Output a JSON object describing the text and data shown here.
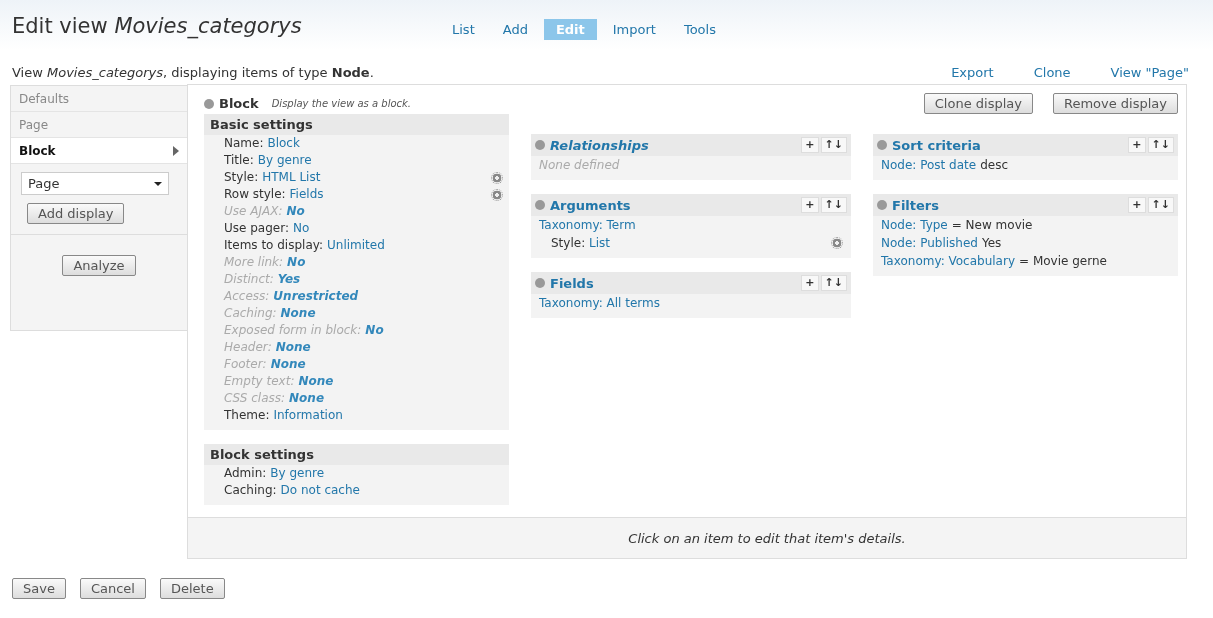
{
  "page_title": {
    "text": "Edit view",
    "name": "Movies_categorys"
  },
  "tabs": [
    {
      "label": "List",
      "selected": false
    },
    {
      "label": "Add",
      "selected": false
    },
    {
      "label": "Edit",
      "selected": true
    },
    {
      "label": "Import",
      "selected": false
    },
    {
      "label": "Tools",
      "selected": false
    }
  ],
  "description": {
    "text": "View *Movies_categorys*, displaying items of type **Node**."
  },
  "links": [
    "Export",
    "Clone",
    "View \"Page\""
  ],
  "displays": [
    {
      "label": "Defaults",
      "selected": false
    },
    {
      "label": "Page",
      "selected": false
    },
    {
      "label": "Block",
      "selected": true
    }
  ],
  "display_select": {
    "value": "Page"
  },
  "add_display_button": "Add display",
  "analyze_button": "Analyze",
  "display_header": {
    "title": "Block",
    "description": "Display the view as a block."
  },
  "display_buttons": [
    "Clone display",
    "Remove display"
  ],
  "basic_settings": {
    "title": "Basic settings",
    "items": [
      {
        "label": "Name:",
        "value": "Block",
        "defaulted": false,
        "settings_icon": false
      },
      {
        "label": "Title:",
        "value": "By genre",
        "defaulted": false,
        "settings_icon": false
      },
      {
        "label": "Style:",
        "value": "HTML List",
        "defaulted": false,
        "settings_icon": true
      },
      {
        "label": "Row style:",
        "value": "Fields",
        "defaulted": false,
        "settings_icon": true
      },
      {
        "label": "Use AJAX:",
        "value": "No",
        "defaulted": true,
        "settings_icon": false
      },
      {
        "label": "Use pager:",
        "value": "No",
        "defaulted": false,
        "settings_icon": false
      },
      {
        "label": "Items to display:",
        "value": "Unlimited",
        "defaulted": false,
        "settings_icon": false
      },
      {
        "label": "More link:",
        "value": "No",
        "defaulted": true,
        "settings_icon": false
      },
      {
        "label": "Distinct:",
        "value": "Yes",
        "defaulted": true,
        "settings_icon": false
      },
      {
        "label": "Access:",
        "value": "Unrestricted",
        "defaulted": true,
        "settings_icon": false
      },
      {
        "label": "Caching:",
        "value": "None",
        "defaulted": true,
        "settings_icon": false
      },
      {
        "label": "Exposed form in block:",
        "value": "No",
        "defaulted": true,
        "settings_icon": false
      },
      {
        "label": "Header:",
        "value": "None",
        "defaulted": true,
        "settings_icon": false
      },
      {
        "label": "Footer:",
        "value": "None",
        "defaulted": true,
        "settings_icon": false
      },
      {
        "label": "Empty text:",
        "value": "None",
        "defaulted": true,
        "settings_icon": false
      },
      {
        "label": "CSS class:",
        "value": "None",
        "defaulted": true,
        "settings_icon": false
      },
      {
        "label": "Theme:",
        "value": "Information",
        "defaulted": false,
        "settings_icon": false
      }
    ]
  },
  "block_settings": {
    "title": "Block settings",
    "items": [
      {
        "label": "Admin:",
        "value": "By genre",
        "defaulted": false,
        "settings_icon": false
      },
      {
        "label": "Caching:",
        "value": "Do not cache",
        "defaulted": false,
        "settings_icon": false
      }
    ]
  },
  "middle_sections": [
    {
      "title": "Relationships",
      "defaulted": true,
      "items": [
        {
          "kind": "empty",
          "text": "None defined"
        }
      ]
    },
    {
      "title": "Arguments",
      "defaulted": false,
      "items": [
        {
          "kind": "link",
          "link": "Taxonomy: Term"
        },
        {
          "kind": "setting",
          "label": "Style:",
          "value": "List"
        }
      ]
    },
    {
      "title": "Fields",
      "defaulted": false,
      "items": [
        {
          "kind": "link",
          "link": "Taxonomy: All terms"
        }
      ]
    }
  ],
  "right_sections": [
    {
      "title": "Sort criteria",
      "defaulted": false,
      "items": [
        {
          "kind": "link",
          "link": "Node: Post date",
          "text": "desc"
        }
      ]
    },
    {
      "title": "Filters",
      "defaulted": false,
      "items": [
        {
          "kind": "link",
          "link": "Node: Type",
          "text": "= New movie"
        },
        {
          "kind": "link",
          "link": "Node: Published",
          "text": "Yes"
        },
        {
          "kind": "link",
          "link": "Taxonomy: Vocabulary",
          "text": "= Movie gerne"
        }
      ]
    }
  ],
  "add_icon": "+",
  "rearrange_icon": "↑↓",
  "footer_hint": "Click on an item to edit that item's details.",
  "bottom_buttons": [
    "Save",
    "Cancel",
    "Delete"
  ]
}
